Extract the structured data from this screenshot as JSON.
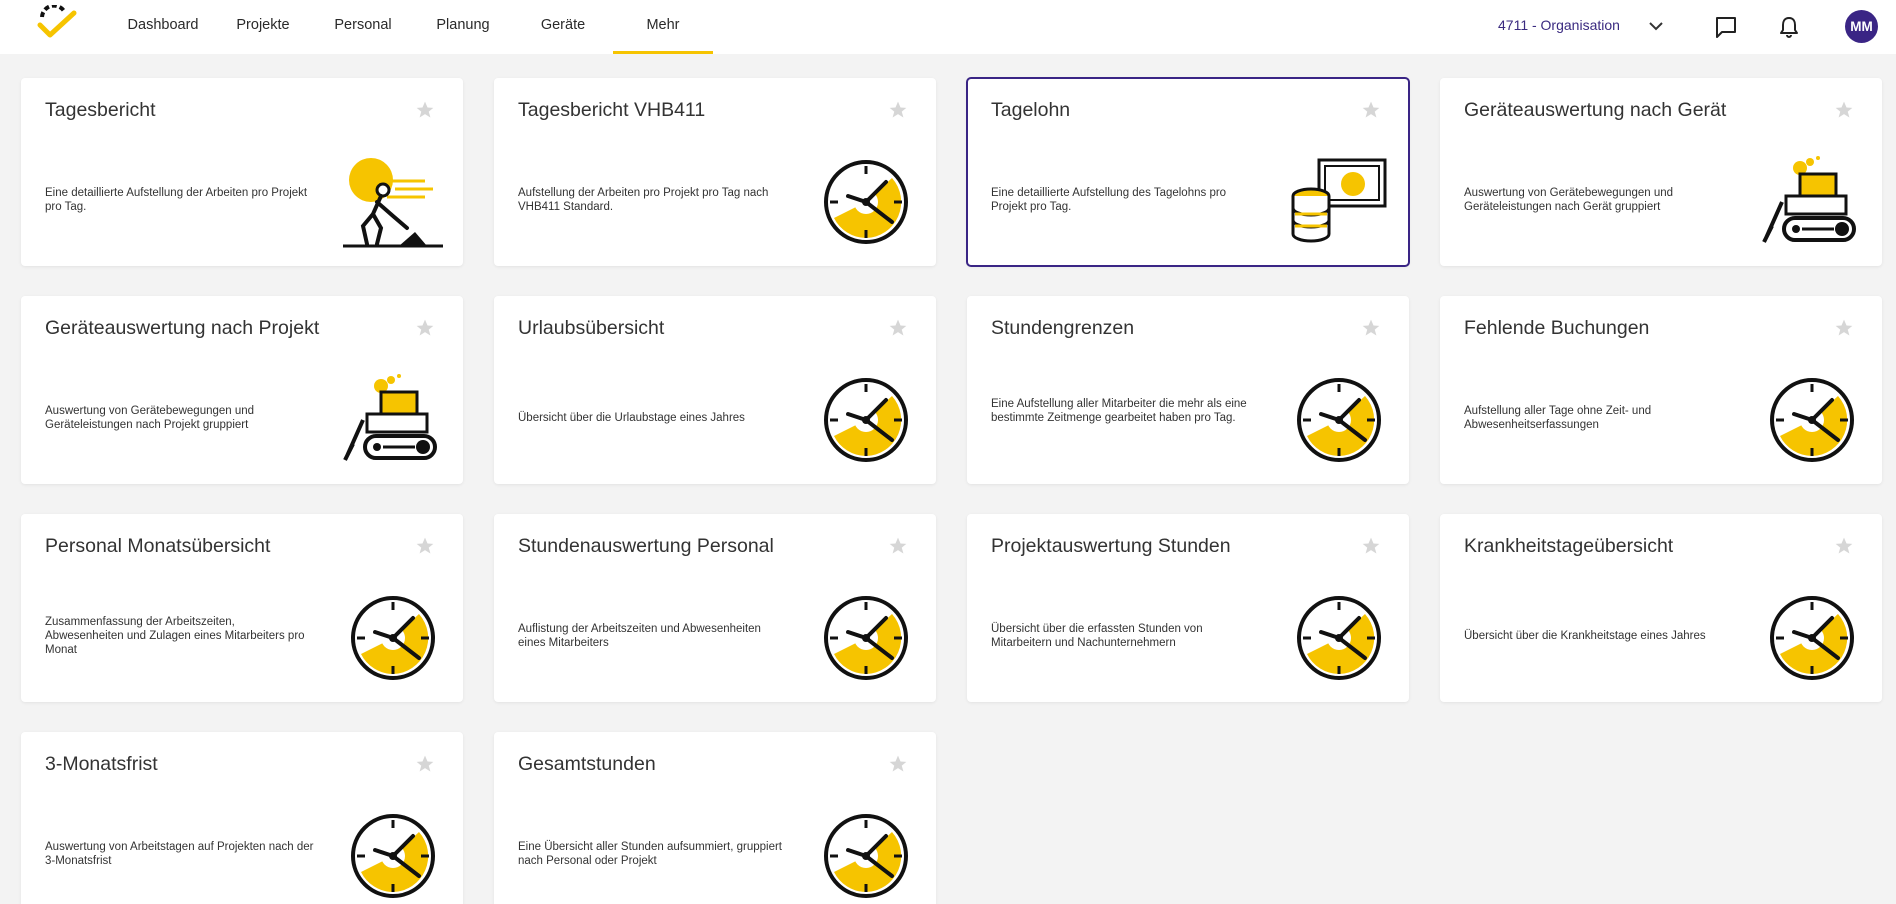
{
  "colors": {
    "accent": "#f6c400",
    "brand": "#3a2585",
    "background": "#f3f3f3"
  },
  "nav": [
    {
      "label": "Dashboard",
      "active": false
    },
    {
      "label": "Projekte",
      "active": false
    },
    {
      "label": "Personal",
      "active": false
    },
    {
      "label": "Planung",
      "active": false
    },
    {
      "label": "Geräte",
      "active": false
    },
    {
      "label": "Mehr",
      "active": true
    }
  ],
  "header": {
    "org_label": "4711 - Organisation",
    "org_icon": "chevron-down-icon",
    "messages_icon": "chat-icon",
    "notifications_icon": "bell-icon",
    "avatar_initials": "MM"
  },
  "cards": [
    {
      "title": "Tagesbericht",
      "description": "Eine detaillierte Aufstellung der Arbeiten pro Projekt pro Tag.",
      "illustration": "worker",
      "selected": false
    },
    {
      "title": "Tagesbericht VHB411",
      "description": "Aufstellung der Arbeiten pro Projekt pro Tag nach VHB411 Standard.",
      "illustration": "clock",
      "selected": false
    },
    {
      "title": "Tagelohn",
      "description": "Eine detaillierte Aufstellung des Tagelohns pro Projekt pro Tag.",
      "illustration": "money",
      "selected": true
    },
    {
      "title": "Geräteauswertung nach Gerät",
      "description": "Auswertung von Gerätebewegungen und Geräteleistungen nach Gerät gruppiert",
      "illustration": "bulldozer",
      "selected": false
    },
    {
      "title": "Geräteauswertung nach Projekt",
      "description": "Auswertung von Gerätebewegungen und Geräteleistungen nach Projekt gruppiert",
      "illustration": "bulldozer",
      "selected": false
    },
    {
      "title": "Urlaubsübersicht",
      "description": "Übersicht über die Urlaubstage eines Jahres",
      "illustration": "clock",
      "selected": false
    },
    {
      "title": "Stundengrenzen",
      "description": "Eine Aufstellung aller Mitarbeiter die mehr als eine bestimmte Zeitmenge gearbeitet haben pro Tag.",
      "illustration": "clock",
      "selected": false
    },
    {
      "title": "Fehlende Buchungen",
      "description": "Aufstellung aller Tage ohne Zeit- und Abwesenheitserfassungen",
      "illustration": "clock",
      "selected": false
    },
    {
      "title": "Personal Monatsübersicht",
      "description": "Zusammenfassung der Arbeitszeiten, Abwesenheiten und Zulagen eines Mitarbeiters pro Monat",
      "illustration": "clock",
      "selected": false
    },
    {
      "title": "Stundenauswertung Personal",
      "description": "Auflistung der Arbeitszeiten und Abwesenheiten eines Mitarbeiters",
      "illustration": "clock",
      "selected": false
    },
    {
      "title": "Projektauswertung Stunden",
      "description": "Übersicht über die erfassten Stunden von Mitarbeitern und Nachunternehmern",
      "illustration": "clock",
      "selected": false
    },
    {
      "title": "Krankheitstageübersicht",
      "description": "Übersicht über die Krankheitstage eines Jahres",
      "illustration": "clock",
      "selected": false
    },
    {
      "title": "3-Monatsfrist",
      "description": "Auswertung von Arbeitstagen auf Projekten nach der 3-Monatsfrist",
      "illustration": "clock",
      "selected": false
    },
    {
      "title": "Gesamtstunden",
      "description": "Eine Übersicht aller Stunden aufsummiert, gruppiert nach Personal oder Projekt",
      "illustration": "clock",
      "selected": false
    }
  ]
}
